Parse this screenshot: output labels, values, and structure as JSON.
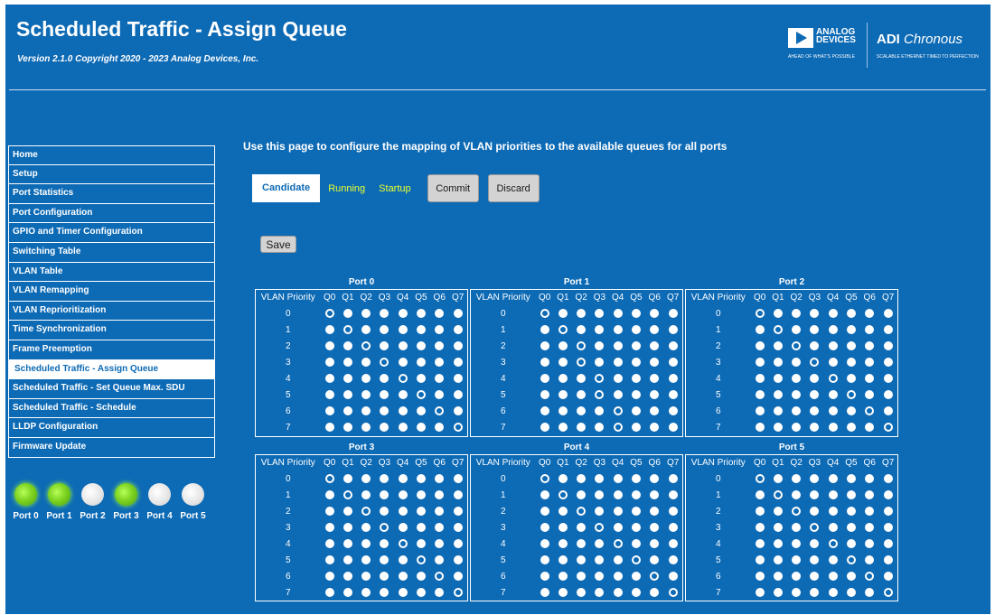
{
  "header": {
    "title": "Scheduled Traffic - Assign Queue",
    "version": "Version 2.1.0 Copyright 2020 - 2023 Analog Devices, Inc.",
    "logo_adi_line1": "ANALOG",
    "logo_adi_line2": "DEVICES",
    "logo_adi_tagline": "AHEAD OF WHAT'S POSSIBLE",
    "logo_chronous_bold": "ADI",
    "logo_chronous_italic": "Chronous",
    "logo_chronous_tagline": "SCALABLE ETHERNET TIMED TO PERFECTION"
  },
  "sidebar": {
    "items": [
      {
        "label": "Home",
        "active": false
      },
      {
        "label": "Setup",
        "active": false
      },
      {
        "label": "Port Statistics",
        "active": false
      },
      {
        "label": "Port Configuration",
        "active": false
      },
      {
        "label": "GPIO and Timer Configuration",
        "active": false
      },
      {
        "label": "Switching Table",
        "active": false
      },
      {
        "label": "VLAN Table",
        "active": false
      },
      {
        "label": "VLAN Remapping",
        "active": false
      },
      {
        "label": "VLAN Reprioritization",
        "active": false
      },
      {
        "label": "Time Synchronization",
        "active": false
      },
      {
        "label": "Frame Preemption",
        "active": false
      },
      {
        "label": "Scheduled Traffic - Assign Queue",
        "active": true
      },
      {
        "label": "Scheduled Traffic - Set Queue Max. SDU",
        "active": false
      },
      {
        "label": "Scheduled Traffic - Schedule",
        "active": false
      },
      {
        "label": "LLDP Configuration",
        "active": false
      },
      {
        "label": "Firmware Update",
        "active": false
      }
    ]
  },
  "port_status": [
    {
      "label": "Port 0",
      "link": true
    },
    {
      "label": "Port 1",
      "link": true
    },
    {
      "label": "Port 2",
      "link": false
    },
    {
      "label": "Port 3",
      "link": true
    },
    {
      "label": "Port 4",
      "link": false
    },
    {
      "label": "Port 5",
      "link": false
    }
  ],
  "main": {
    "intro": "Use this page to configure the mapping of VLAN priorities to the available queues for all ports",
    "tabs": {
      "candidate": "Candidate",
      "running": "Running",
      "startup": "Startup"
    },
    "commit_label": "Commit",
    "discard_label": "Discard",
    "save_label": "Save"
  },
  "queue_table": {
    "priority_header": "VLAN Priority",
    "queue_headers": [
      "Q0",
      "Q1",
      "Q2",
      "Q3",
      "Q4",
      "Q5",
      "Q6",
      "Q7"
    ],
    "priorities": [
      "0",
      "1",
      "2",
      "3",
      "4",
      "5",
      "6",
      "7"
    ],
    "colors": {
      "background": "#0d6ab5",
      "radio": "#ffffff"
    },
    "ports": [
      {
        "title": "Port 0",
        "assigned_queue": [
          0,
          1,
          2,
          3,
          4,
          5,
          6,
          7
        ]
      },
      {
        "title": "Port 1",
        "assigned_queue": [
          0,
          1,
          2,
          2,
          3,
          3,
          4,
          4
        ]
      },
      {
        "title": "Port 2",
        "assigned_queue": [
          0,
          1,
          2,
          3,
          4,
          5,
          6,
          7
        ]
      },
      {
        "title": "Port 3",
        "assigned_queue": [
          0,
          1,
          2,
          3,
          4,
          5,
          6,
          7
        ]
      },
      {
        "title": "Port 4",
        "assigned_queue": [
          0,
          1,
          2,
          3,
          4,
          5,
          6,
          7
        ]
      },
      {
        "title": "Port 5",
        "assigned_queue": [
          0,
          1,
          2,
          3,
          4,
          5,
          6,
          7
        ]
      }
    ]
  }
}
